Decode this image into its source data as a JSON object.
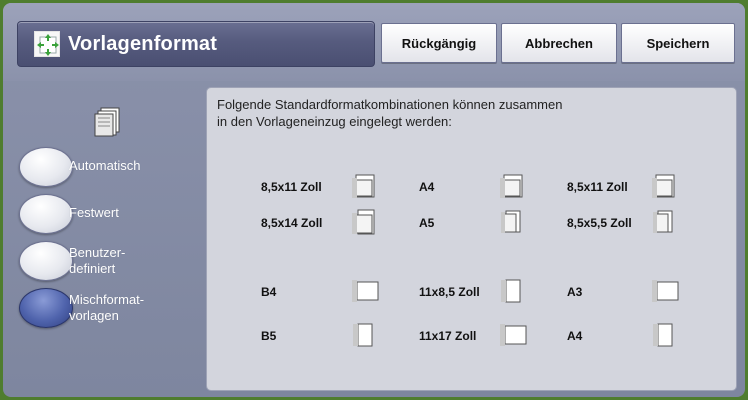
{
  "header": {
    "title": "Vorlagenformat",
    "title_icon": "original-size-icon",
    "buttons": {
      "undo": "Rückgängig",
      "cancel": "Abbrechen",
      "save": "Speichern"
    }
  },
  "options": [
    {
      "label": "Automatisch",
      "selected": false
    },
    {
      "label": "Festwert",
      "selected": false
    },
    {
      "label": "Benutzer-\ndefiniert",
      "selected": false
    },
    {
      "label": "Mischformat-\nvorlagen",
      "selected": true
    }
  ],
  "panel": {
    "description_line1": "Folgende Standardformatkombinationen können zusammen",
    "description_line2": "in den Vorlageneinzug eingelegt werden:",
    "rows": [
      [
        "8,5x11 Zoll",
        "A4",
        "8,5x11 Zoll"
      ],
      [
        "8,5x14 Zoll",
        "A5",
        "8,5x5,5 Zoll"
      ],
      [
        "B4",
        "11x8,5 Zoll",
        "A3"
      ],
      [
        "B5",
        "11x17 Zoll",
        "A4"
      ]
    ]
  },
  "colors": {
    "background_green": "#4f7d2f",
    "header_gray": "#8b92ab",
    "title_bar": "#565b7e",
    "panel": "#d3d5dd",
    "selected_radio": "#4f63ac"
  }
}
